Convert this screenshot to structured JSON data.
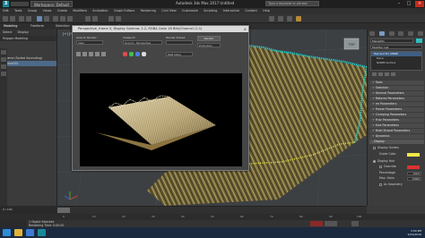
{
  "window": {
    "workspace_label": "Workspace: Default",
    "title": "Autodesk 3ds Max 2017    Untitled",
    "search_placeholder": "Type a keyword or phrase"
  },
  "menubar": {
    "items": [
      "Edit",
      "Tools",
      "Group",
      "Views",
      "Create",
      "Modifiers",
      "Animation",
      "Graph Editors",
      "Rendering",
      "Civil View",
      "Customize",
      "Scripting",
      "Interactive",
      "Content",
      "Help"
    ]
  },
  "ribbon": {
    "tabs": [
      "Modeling",
      "Freeform",
      "Selection",
      "Object Paint",
      "Populate"
    ],
    "subtab": "Polygon Modeling"
  },
  "scene_explorer": {
    "headers": [
      "Select",
      "Display"
    ],
    "rows": [
      {
        "label": "Name (Sorted Ascending)",
        "selected": false
      },
      {
        "label": "Plane001",
        "selected": true
      }
    ]
  },
  "viewport": {
    "label": "[+] [Perspective] [Standard] [Default Shading]"
  },
  "render_frame": {
    "title": "Perspective, frame 0, Display Gamma: 2.2, RGBA Color 16 Bits/Channel (1:1)",
    "area_to_render_label": "Area to Render:",
    "area_to_render_value": "View",
    "viewport_label": "Viewport:",
    "viewport_value": "Quad 4 - Perspective",
    "render_preset_label": "Render Preset:",
    "render_preset_value": "",
    "render_button": "Render",
    "production_value": "Production",
    "channel_value": "RGB Alpha",
    "swatch_colors": [
      "#e04a4a",
      "#3fbf4f",
      "#4a7de0",
      "#dcdcdc"
    ]
  },
  "command_panel": {
    "tabs": [
      "create",
      "modify",
      "hierarchy",
      "motion",
      "display",
      "utilities"
    ],
    "object_name": "Plane001",
    "modifier_list_label": "Modifier List",
    "stack": [
      {
        "label": "Hair and Fur (WSM)",
        "selected": true
      },
      {
        "label": "Plane",
        "selected": false
      },
      {
        "label": "NURBS Surface",
        "selected": false
      }
    ],
    "rollouts": [
      "Tools",
      "Selection",
      "General Parameters",
      "Material Parameters",
      "mr Parameters",
      "Freeze Parameters",
      "Clumping Parameters",
      "Frizz Parameters",
      "Kink Parameters",
      "Multi Strand Parameters",
      "Dynamics",
      "Display"
    ],
    "display": {
      "display_guides_label": "Display Guides",
      "guide_color_label": "Guide Color",
      "guide_color": "#f2e84a",
      "display_hair_label": "Display Hair",
      "override_label": "Override",
      "override_color": "#e03030",
      "percentage_label": "Percentage",
      "percentage_value": "100.0",
      "max_hairs_label": "Max. Hairs",
      "max_hairs_value": "10000",
      "as_geometry_label": "As Geometry"
    }
  },
  "timeline": {
    "frame_readout": "0 / 100",
    "ticks": [
      "0",
      "10",
      "20",
      "30",
      "40",
      "50",
      "60",
      "70",
      "80",
      "90",
      "100"
    ]
  },
  "status": {
    "selected": "1 Object Selected",
    "rendering_time": "Rendering Time: 0:00:00"
  },
  "taskbar": {
    "time": "3:54 PM",
    "date": "9/14/2016"
  }
}
